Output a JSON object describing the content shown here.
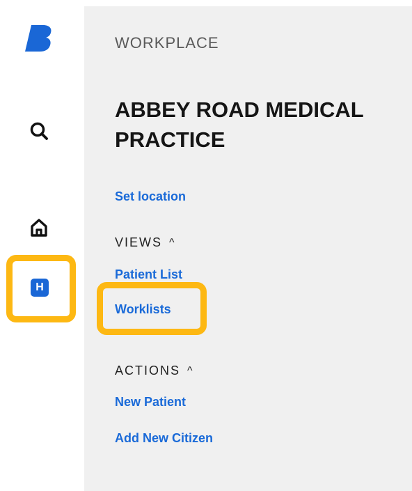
{
  "rail": {
    "logo": {
      "icon": "brand-b-icon",
      "color": "#1a67d6"
    },
    "search": {
      "icon": "search-icon"
    },
    "home": {
      "icon": "home-icon"
    },
    "hub": {
      "icon": "hub-icon",
      "badge": "H",
      "color": "#1a67d6"
    }
  },
  "panel": {
    "eyebrow": "WORKPLACE",
    "title": "ABBEY ROAD MEDICAL PRACTICE",
    "set_location": "Set location",
    "views": {
      "heading": "VIEWS",
      "caret": "^",
      "items": [
        {
          "label": "Patient List"
        },
        {
          "label": "Worklists"
        }
      ]
    },
    "actions": {
      "heading": "ACTIONS",
      "caret": "^",
      "items": [
        {
          "label": "New Patient"
        },
        {
          "label": "Add New Citizen"
        }
      ]
    }
  },
  "colors": {
    "link": "#1a6ad8",
    "highlight": "#FDB813",
    "panel_bg": "#f0f0f0"
  }
}
